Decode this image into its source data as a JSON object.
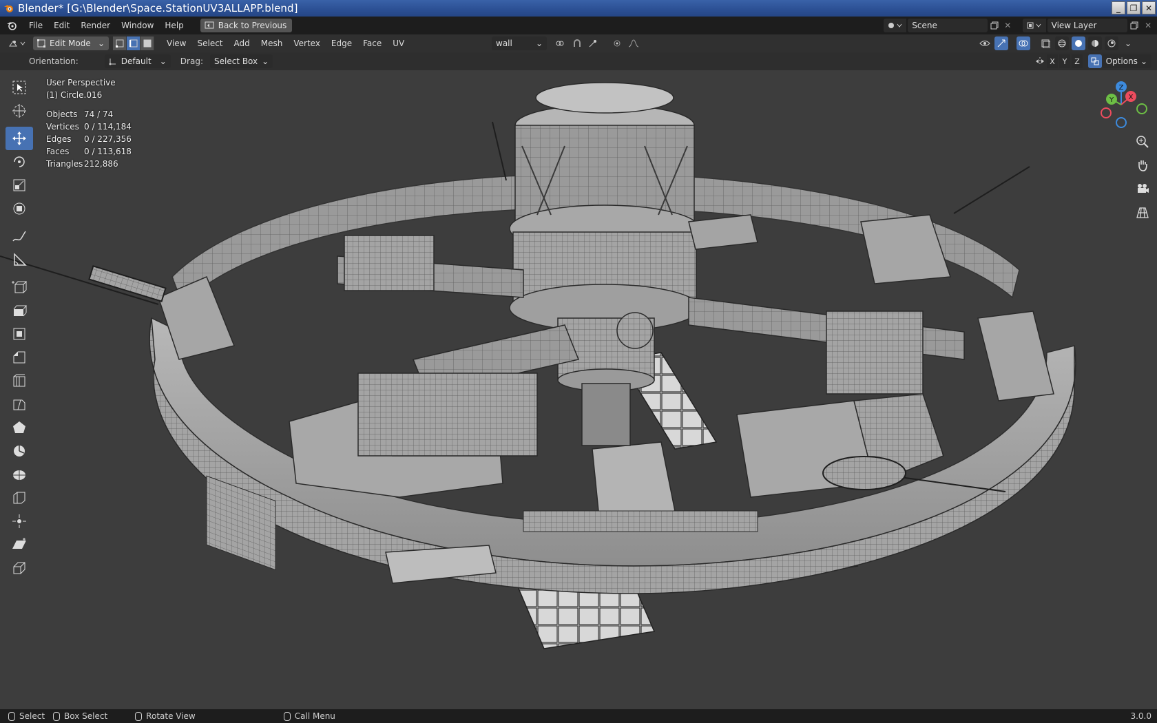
{
  "window": {
    "title": "Blender* [G:\\Blender\\Space.StationUV3ALLAPP.blend]",
    "controls": [
      "minimize",
      "restore",
      "close"
    ]
  },
  "menubar": {
    "items": [
      "File",
      "Edit",
      "Render",
      "Window",
      "Help"
    ],
    "back_button": "Back to Previous",
    "scene": "Scene",
    "view_layer": "View Layer"
  },
  "header": {
    "mode": "Edit Mode",
    "menus": [
      "View",
      "Select",
      "Add",
      "Mesh",
      "Vertex",
      "Edge",
      "Face",
      "UV"
    ],
    "uv_map": "wall"
  },
  "tool_settings": {
    "orientation_label": "Orientation:",
    "orientation_value": "Default",
    "drag_label": "Drag:",
    "drag_value": "Select Box",
    "axes": [
      "X",
      "Y",
      "Z"
    ],
    "options": "Options"
  },
  "viewport": {
    "view_name": "User Perspective",
    "object_name": "(1) Circle.016",
    "stats": [
      {
        "label": "Objects",
        "value": "74 / 74"
      },
      {
        "label": "Vertices",
        "value": "0 / 114,184"
      },
      {
        "label": "Edges",
        "value": "0 / 227,356"
      },
      {
        "label": "Faces",
        "value": "0 / 113,618"
      },
      {
        "label": "Triangles",
        "value": "212,886"
      }
    ],
    "gizmo_axes": {
      "z": "Z",
      "x": "X",
      "y": "Y"
    }
  },
  "statusbar": {
    "items": [
      "Select",
      "Box Select",
      "Rotate View",
      "Call Menu"
    ],
    "version": "3.0.0"
  },
  "colors": {
    "accent": "#4772b3",
    "bg_viewport": "#3d3d3d",
    "axis_x": "#ed4c5e",
    "axis_y": "#6dbf45",
    "axis_z": "#3d8bde"
  }
}
